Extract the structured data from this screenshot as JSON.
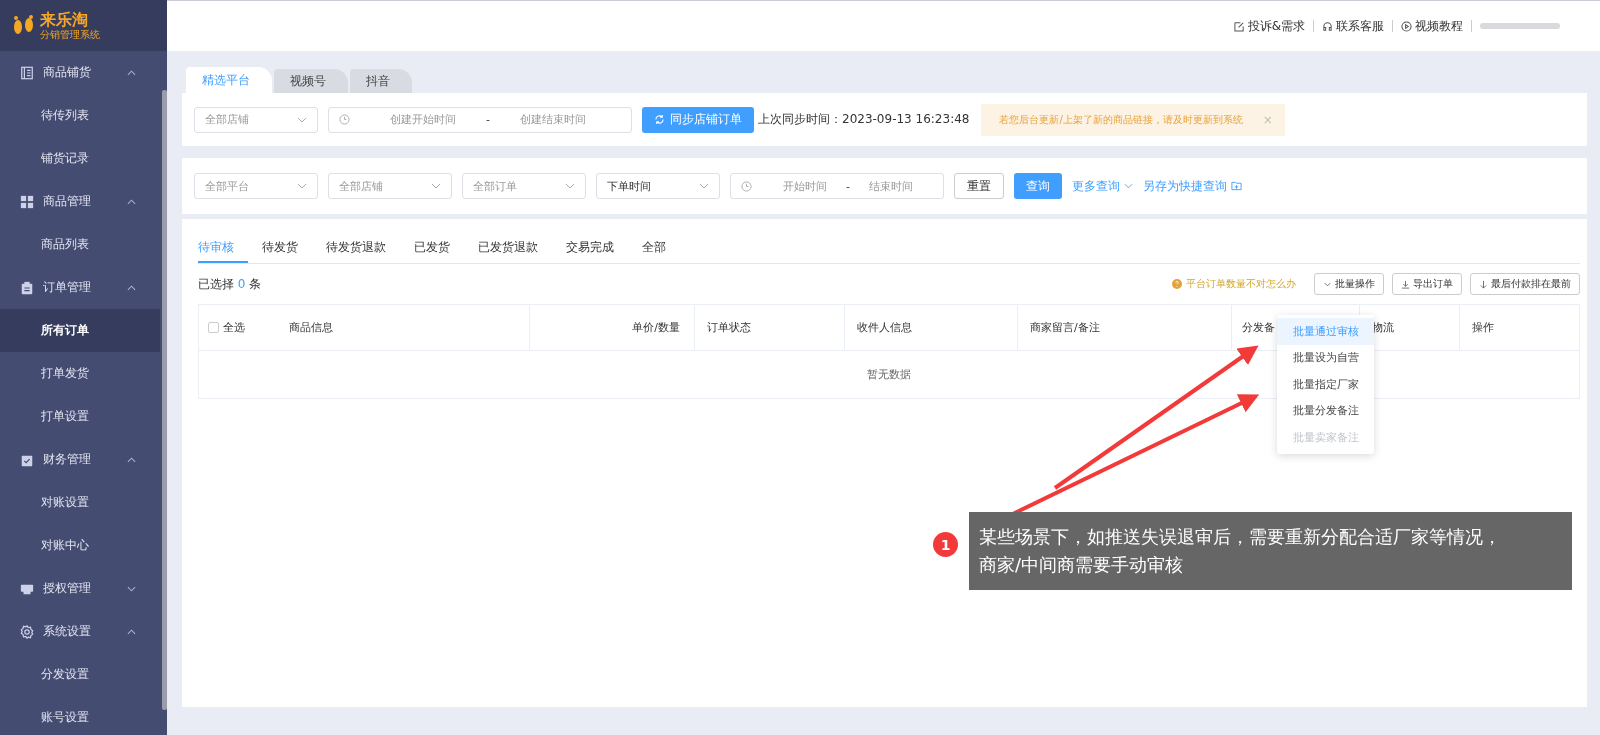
{
  "logo": {
    "name": "来乐淘",
    "subtitle": "分销管理系统"
  },
  "sidebar": {
    "groups": [
      {
        "label": "商品铺货",
        "expanded": true,
        "children": [
          {
            "label": "待传列表",
            "selected": false
          },
          {
            "label": "铺货记录",
            "selected": false
          }
        ]
      },
      {
        "label": "商品管理",
        "expanded": true,
        "children": [
          {
            "label": "商品列表",
            "selected": false
          }
        ]
      },
      {
        "label": "订单管理",
        "expanded": true,
        "children": [
          {
            "label": "所有订单",
            "selected": true
          },
          {
            "label": "打单发货",
            "selected": false
          },
          {
            "label": "打单设置",
            "selected": false
          }
        ]
      },
      {
        "label": "财务管理",
        "expanded": true,
        "children": [
          {
            "label": "对账设置",
            "selected": false
          },
          {
            "label": "对账中心",
            "selected": false
          }
        ]
      },
      {
        "label": "授权管理",
        "expanded": false
      },
      {
        "label": "系统设置",
        "expanded": true,
        "children": [
          {
            "label": "分发设置",
            "selected": false
          },
          {
            "label": "账号设置",
            "selected": false
          }
        ]
      }
    ]
  },
  "header_links": [
    "投诉&需求",
    "联系客服",
    "视频教程"
  ],
  "platform_tabs": [
    {
      "label": "精选平台",
      "selected": true
    },
    {
      "label": "视频号",
      "selected": false
    },
    {
      "label": "抖音",
      "selected": false
    }
  ],
  "sync_bar": {
    "shop_select": {
      "placeholder": "全部店铺"
    },
    "start_placeholder": "创建开始时间",
    "separator": "-",
    "end_placeholder": "创建结束时间",
    "sync_button": "同步店铺订单",
    "last_sync": "上次同步时间：2023-09-13 16:23:48",
    "notice": "若您后台更新/上架了新的商品链接，请及时更新到系统",
    "notice_close": "×"
  },
  "filters": {
    "selects": [
      {
        "placeholder": "全部平台"
      },
      {
        "placeholder": "全部店铺"
      },
      {
        "placeholder": "全部订单"
      },
      {
        "value": "下单时间"
      }
    ],
    "start_placeholder": "开始时间",
    "separator": "-",
    "end_placeholder": "结束时间",
    "reset_button": "重置",
    "query_button": "查询",
    "more_query": "更多查询",
    "save_query": "另存为快捷查询"
  },
  "order_tabs": [
    {
      "label": "待审核",
      "selected": true
    },
    {
      "label": "待发货",
      "selected": false
    },
    {
      "label": "待发货退款",
      "selected": false
    },
    {
      "label": "已发货",
      "selected": false
    },
    {
      "label": "已发货退款",
      "selected": false
    },
    {
      "label": "交易完成",
      "selected": false
    },
    {
      "label": "全部",
      "selected": false
    }
  ],
  "selection": {
    "prefix": "已选择",
    "count": "0",
    "suffix": "条"
  },
  "help_link": "平台订单数量不对怎么办",
  "toolbar_buttons": [
    {
      "label": "批量操作",
      "kind": "dropdown"
    },
    {
      "label": "导出订单",
      "kind": "export"
    },
    {
      "label": "最后付款排在最前",
      "kind": "sort"
    }
  ],
  "table": {
    "select_all": {
      "label": "全选",
      "checked": false
    },
    "columns": [
      "商品信息",
      "单价/数量",
      "订单状态",
      "收件人信息",
      "商家留言/备注",
      "分发备",
      "物流",
      "操作"
    ],
    "empty_text": "暂无数据"
  },
  "batch_menu": [
    {
      "label": "批量通过审核",
      "selected": true,
      "disabled": false
    },
    {
      "label": "批量设为自营",
      "selected": false,
      "disabled": false
    },
    {
      "label": "批量指定厂家",
      "selected": false,
      "disabled": false
    },
    {
      "label": "批量分发备注",
      "selected": false,
      "disabled": false
    },
    {
      "label": "批量卖家备注",
      "selected": false,
      "disabled": true
    }
  ],
  "annotation": {
    "number": "1",
    "lines": [
      "某些场景下，如推送失误退审后，需要重新分配合适厂家等情况，",
      "商家/中间商需要手动审核"
    ]
  }
}
